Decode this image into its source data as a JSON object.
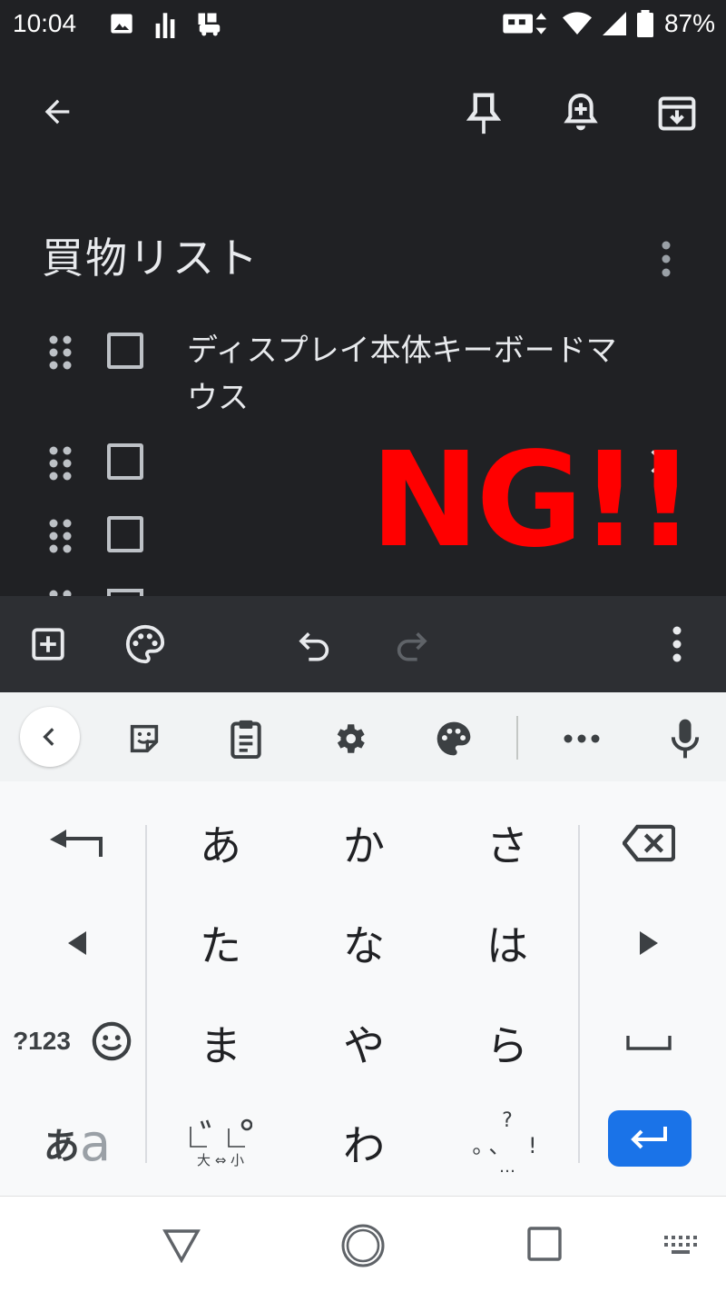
{
  "status_bar": {
    "time": "10:04",
    "battery": "87%",
    "icons": [
      "image-icon",
      "signal-bars-icon",
      "car-icon",
      "data-transfer-icon",
      "wifi-icon",
      "cell-signal-icon",
      "battery-icon"
    ]
  },
  "toolbar": {
    "back_icon": "arrow-back-icon",
    "pin_icon": "pin-icon",
    "reminder_icon": "add-alert-icon",
    "archive_icon": "archive-icon"
  },
  "note": {
    "title": "買物リスト",
    "items": [
      {
        "text": "ディスプレイ本体キーボードマウス",
        "checked": false
      },
      {
        "text": "",
        "checked": false
      },
      {
        "text": "",
        "checked": false
      }
    ]
  },
  "overlay_text": "NG!!",
  "bottom_bar": {
    "icons": [
      "add-box-icon",
      "palette-icon",
      "undo-icon",
      "redo-icon",
      "more-vert-icon"
    ]
  },
  "keyboard": {
    "suggestion_icons": [
      "back-chevron-icon",
      "sticker-icon",
      "clipboard-icon",
      "settings-icon",
      "theme-palette-icon",
      "more-dots-icon",
      "mic-icon"
    ],
    "row1": [
      "あ",
      "か",
      "さ"
    ],
    "row2": [
      "た",
      "な",
      "は"
    ],
    "row3": [
      "ま",
      "や",
      "ら"
    ],
    "row4_wa": "わ",
    "symbols_key": "?123",
    "mode_key_main": "あ",
    "mode_key_sub": "a",
    "dakuten_sub": "大 ⇔ 小",
    "punct_top": "?",
    "punct_mid": "。、 !",
    "punct_bottom": "…"
  },
  "colors": {
    "note_bg": "#202124",
    "overlay": "#ff0000",
    "enter_key": "#1a73e8"
  }
}
